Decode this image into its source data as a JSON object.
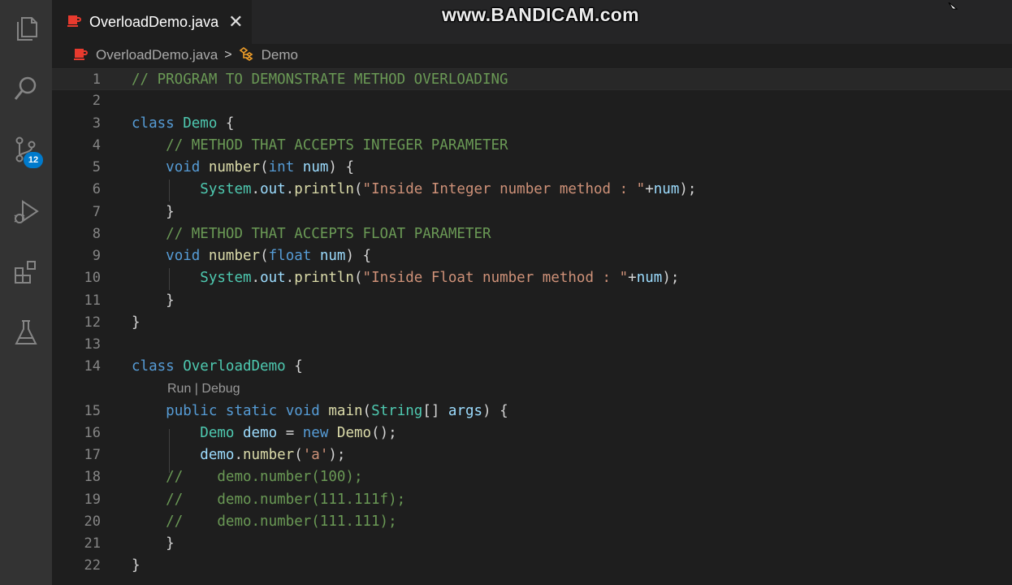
{
  "tab": {
    "filename": "OverloadDemo.java",
    "close_glyph": "✕"
  },
  "watermark": "www.BANDICAM.com",
  "breadcrumb": {
    "file": "OverloadDemo.java",
    "separator": ">",
    "symbol": "Demo"
  },
  "activity_bar": {
    "items": [
      {
        "name": "explorer-icon"
      },
      {
        "name": "search-icon"
      },
      {
        "name": "source-control-icon",
        "badge": "12"
      },
      {
        "name": "run-debug-icon"
      },
      {
        "name": "extensions-icon"
      },
      {
        "name": "testing-icon"
      }
    ]
  },
  "code_lens": {
    "run": "Run",
    "sep": " | ",
    "debug": "Debug"
  },
  "colors": {
    "keyword": "#569cd6",
    "type": "#4ec9b0",
    "function": "#dcdcaa",
    "variable": "#9cdcfe",
    "string": "#ce9178",
    "comment": "#6a9955",
    "number": "#b5cea8",
    "badge": "#007acc"
  },
  "editor": {
    "lines": [
      {
        "n": "1",
        "tokens": [
          [
            "c",
            "// PROGRAM TO DEMONSTRATE METHOD OVERLOADING"
          ]
        ]
      },
      {
        "n": "2",
        "tokens": []
      },
      {
        "n": "3",
        "tokens": [
          [
            "k",
            "class"
          ],
          [
            "p",
            " "
          ],
          [
            "t",
            "Demo"
          ],
          [
            "p",
            " {"
          ]
        ]
      },
      {
        "n": "4",
        "tokens": [
          [
            "p",
            "    "
          ],
          [
            "c",
            "// METHOD THAT ACCEPTS INTEGER PARAMETER"
          ]
        ]
      },
      {
        "n": "5",
        "tokens": [
          [
            "p",
            "    "
          ],
          [
            "k",
            "void"
          ],
          [
            "p",
            " "
          ],
          [
            "f",
            "number"
          ],
          [
            "p",
            "("
          ],
          [
            "k",
            "int"
          ],
          [
            "p",
            " "
          ],
          [
            "v",
            "num"
          ],
          [
            "p",
            ") {"
          ]
        ]
      },
      {
        "n": "6",
        "tokens": [
          [
            "p",
            "        "
          ],
          [
            "t",
            "System"
          ],
          [
            "p",
            "."
          ],
          [
            "v",
            "out"
          ],
          [
            "p",
            "."
          ],
          [
            "f",
            "println"
          ],
          [
            "p",
            "("
          ],
          [
            "s",
            "\"Inside Integer number method : \""
          ],
          [
            "p",
            "+"
          ],
          [
            "v",
            "num"
          ],
          [
            "p",
            ");"
          ]
        ]
      },
      {
        "n": "7",
        "tokens": [
          [
            "p",
            "    }"
          ]
        ]
      },
      {
        "n": "8",
        "tokens": [
          [
            "p",
            "    "
          ],
          [
            "c",
            "// METHOD THAT ACCEPTS FLOAT PARAMETER"
          ]
        ]
      },
      {
        "n": "9",
        "tokens": [
          [
            "p",
            "    "
          ],
          [
            "k",
            "void"
          ],
          [
            "p",
            " "
          ],
          [
            "f",
            "number"
          ],
          [
            "p",
            "("
          ],
          [
            "k",
            "float"
          ],
          [
            "p",
            " "
          ],
          [
            "v",
            "num"
          ],
          [
            "p",
            ") {"
          ]
        ]
      },
      {
        "n": "10",
        "tokens": [
          [
            "p",
            "        "
          ],
          [
            "t",
            "System"
          ],
          [
            "p",
            "."
          ],
          [
            "v",
            "out"
          ],
          [
            "p",
            "."
          ],
          [
            "f",
            "println"
          ],
          [
            "p",
            "("
          ],
          [
            "s",
            "\"Inside Float number method : \""
          ],
          [
            "p",
            "+"
          ],
          [
            "v",
            "num"
          ],
          [
            "p",
            ");"
          ]
        ]
      },
      {
        "n": "11",
        "tokens": [
          [
            "p",
            "    }"
          ]
        ]
      },
      {
        "n": "12",
        "tokens": [
          [
            "p",
            "}"
          ]
        ]
      },
      {
        "n": "13",
        "tokens": []
      },
      {
        "n": "14",
        "tokens": [
          [
            "k",
            "class"
          ],
          [
            "p",
            " "
          ],
          [
            "t",
            "OverloadDemo"
          ],
          [
            "p",
            " {"
          ]
        ]
      },
      {
        "n": "15",
        "tokens": [
          [
            "p",
            "    "
          ],
          [
            "k",
            "public"
          ],
          [
            "p",
            " "
          ],
          [
            "k",
            "static"
          ],
          [
            "p",
            " "
          ],
          [
            "k",
            "void"
          ],
          [
            "p",
            " "
          ],
          [
            "f",
            "main"
          ],
          [
            "p",
            "("
          ],
          [
            "t",
            "String"
          ],
          [
            "p",
            "[] "
          ],
          [
            "v",
            "args"
          ],
          [
            "p",
            ") {"
          ]
        ]
      },
      {
        "n": "16",
        "tokens": [
          [
            "p",
            "        "
          ],
          [
            "t",
            "Demo"
          ],
          [
            "p",
            " "
          ],
          [
            "v",
            "demo"
          ],
          [
            "p",
            " = "
          ],
          [
            "k",
            "new"
          ],
          [
            "p",
            " "
          ],
          [
            "f",
            "Demo"
          ],
          [
            "p",
            "();"
          ]
        ]
      },
      {
        "n": "17",
        "tokens": [
          [
            "p",
            "        "
          ],
          [
            "v",
            "demo"
          ],
          [
            "p",
            "."
          ],
          [
            "f",
            "number"
          ],
          [
            "p",
            "("
          ],
          [
            "s",
            "'a'"
          ],
          [
            "p",
            ");"
          ]
        ]
      },
      {
        "n": "18",
        "tokens": [
          [
            "p",
            "    "
          ],
          [
            "c",
            "//    demo.number(100);"
          ]
        ]
      },
      {
        "n": "19",
        "tokens": [
          [
            "p",
            "    "
          ],
          [
            "c",
            "//    demo.number(111.111f);"
          ]
        ]
      },
      {
        "n": "20",
        "tokens": [
          [
            "p",
            "    "
          ],
          [
            "c",
            "//    demo.number(111.111);"
          ]
        ]
      },
      {
        "n": "21",
        "tokens": [
          [
            "p",
            "    }"
          ]
        ]
      },
      {
        "n": "22",
        "tokens": [
          [
            "p",
            "}"
          ]
        ]
      }
    ]
  }
}
